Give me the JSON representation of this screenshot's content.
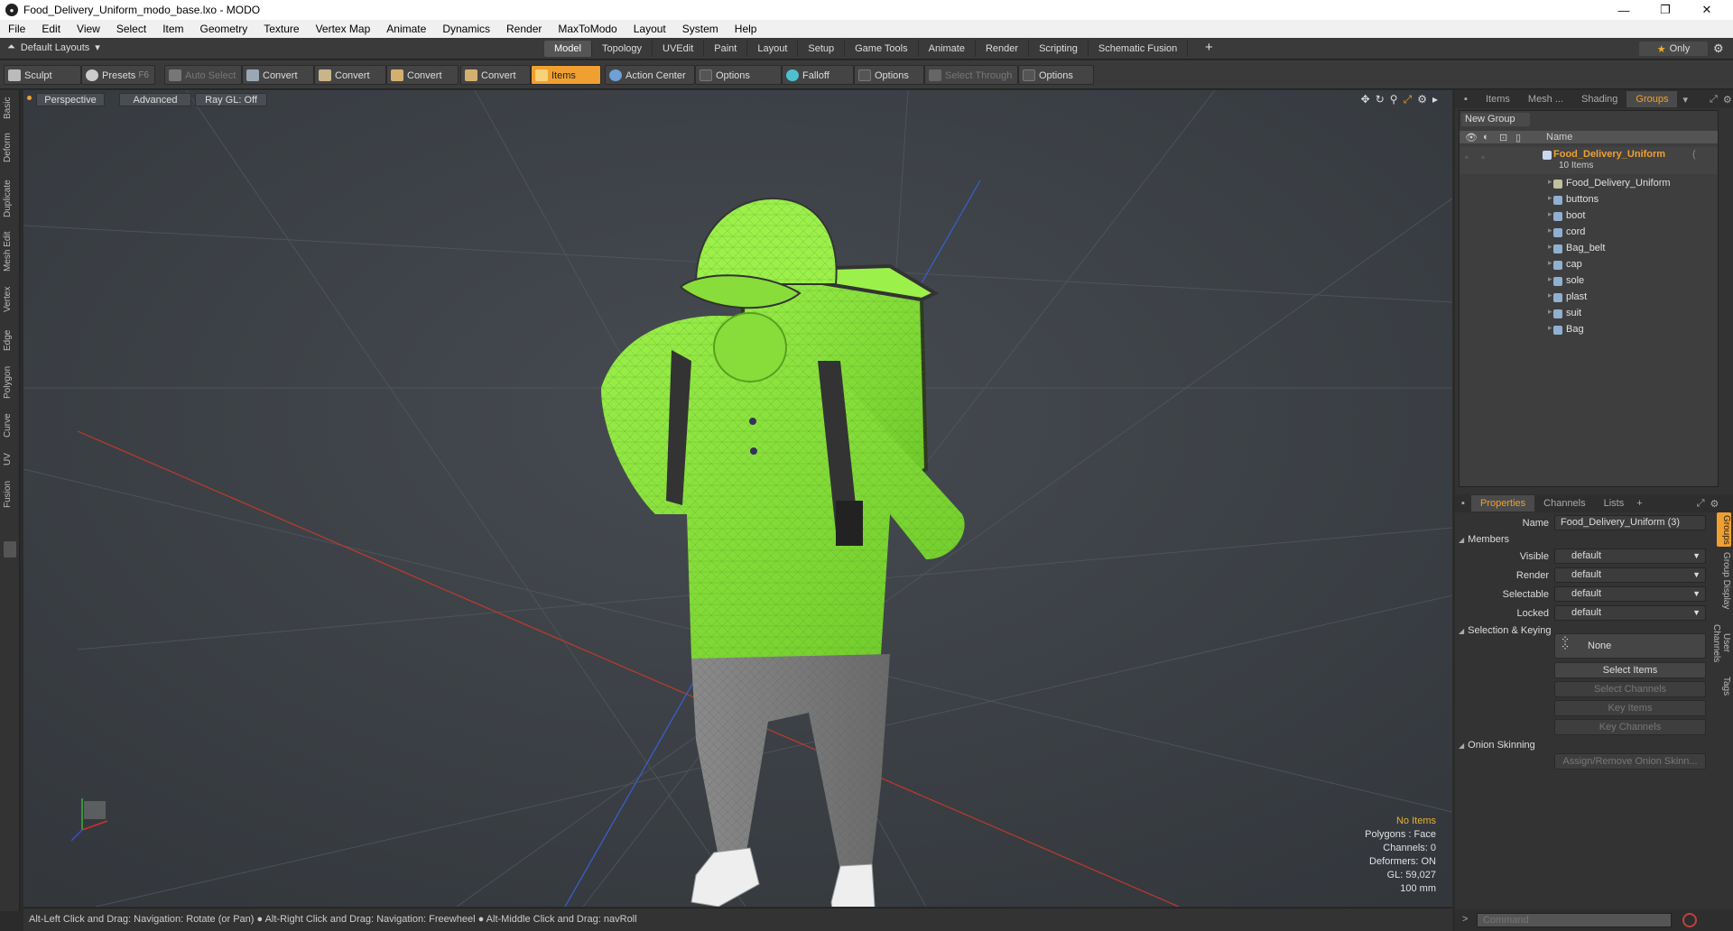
{
  "window": {
    "title": "Food_Delivery_Uniform_modo_base.lxo - MODO",
    "minimize": "—",
    "maximize": "❐",
    "close": "✕"
  },
  "menu": [
    "File",
    "Edit",
    "View",
    "Select",
    "Item",
    "Geometry",
    "Texture",
    "Vertex Map",
    "Animate",
    "Dynamics",
    "Render",
    "MaxToModo",
    "Layout",
    "System",
    "Help"
  ],
  "layouts": {
    "label": "Default Layouts"
  },
  "mode_tabs": [
    {
      "label": "Model",
      "active": true
    },
    {
      "label": "Topology"
    },
    {
      "label": "UVEdit"
    },
    {
      "label": "Paint"
    },
    {
      "label": "Layout"
    },
    {
      "label": "Setup"
    },
    {
      "label": "Game Tools"
    },
    {
      "label": "Animate"
    },
    {
      "label": "Render"
    },
    {
      "label": "Scripting"
    },
    {
      "label": "Schematic Fusion"
    }
  ],
  "only_label": "Only",
  "toolbar": {
    "sculpt": "Sculpt",
    "presets": "Presets",
    "presets_key": "F6",
    "auto_select": "Auto Select",
    "convert1": "Convert",
    "convert2": "Convert",
    "convert3": "Convert",
    "convert4": "Convert",
    "items": "Items",
    "action_center": "Action Center",
    "options1": "Options",
    "falloff": "Falloff",
    "options2": "Options",
    "select_through": "Select Through",
    "options3": "Options"
  },
  "left_tabs": [
    "Basic",
    "Deform",
    "Duplicate",
    "Mesh Edit",
    "Vertex",
    "Edge",
    "Polygon",
    "Curve",
    "UV",
    "Fusion"
  ],
  "viewport": {
    "perspective": "Perspective",
    "advanced": "Advanced",
    "raygl": "Ray GL: Off",
    "info": {
      "items": "No Items",
      "polygons": "Polygons : Face",
      "channels": "Channels: 0",
      "deformers": "Deformers: ON",
      "gl": "GL: 59,027",
      "scale": "100 mm"
    }
  },
  "status": "Alt-Left Click and Drag: Navigation: Rotate (or Pan) ● Alt-Right Click and Drag: Navigation: Freewheel ● Alt-Middle Click and Drag: navRoll",
  "right_tabs": [
    {
      "label": "Items"
    },
    {
      "label": "Mesh ..."
    },
    {
      "label": "Shading"
    },
    {
      "label": "Groups",
      "active": true
    }
  ],
  "groups": {
    "new_group": "New Group",
    "name_col": "Name",
    "root": {
      "label": "Food_Delivery_Uniform",
      "suffix": "(",
      "count": "10 Items"
    },
    "items": [
      "Food_Delivery_Uniform",
      "buttons",
      "boot",
      "cord",
      "Bag_belt",
      "cap",
      "sole",
      "plast",
      "suit",
      "Bag"
    ]
  },
  "props_tabs": [
    {
      "label": "Properties",
      "active": true
    },
    {
      "label": "Channels"
    },
    {
      "label": "Lists"
    }
  ],
  "props": {
    "name_label": "Name",
    "name_value": "Food_Delivery_Uniform (3)",
    "members": "Members",
    "visible_label": "Visible",
    "visible_value": "default",
    "render_label": "Render",
    "render_value": "default",
    "selectable_label": "Selectable",
    "selectable_value": "default",
    "locked_label": "Locked",
    "locked_value": "default",
    "sel_keying": "Selection & Keying",
    "none": "None",
    "select_items": "Select Items",
    "select_channels": "Select Channels",
    "key_items": "Key Items",
    "key_channels": "Key Channels",
    "onion": "Onion Skinning",
    "assign_onion": "Assign/Remove Onion Skinn..."
  },
  "right_vtabs": [
    "Groups",
    "Group Display",
    "User Channels",
    "Tags"
  ],
  "command_placeholder": "Command",
  "colors": {
    "accent": "#f0a030",
    "model_green": "#8ee83a"
  }
}
